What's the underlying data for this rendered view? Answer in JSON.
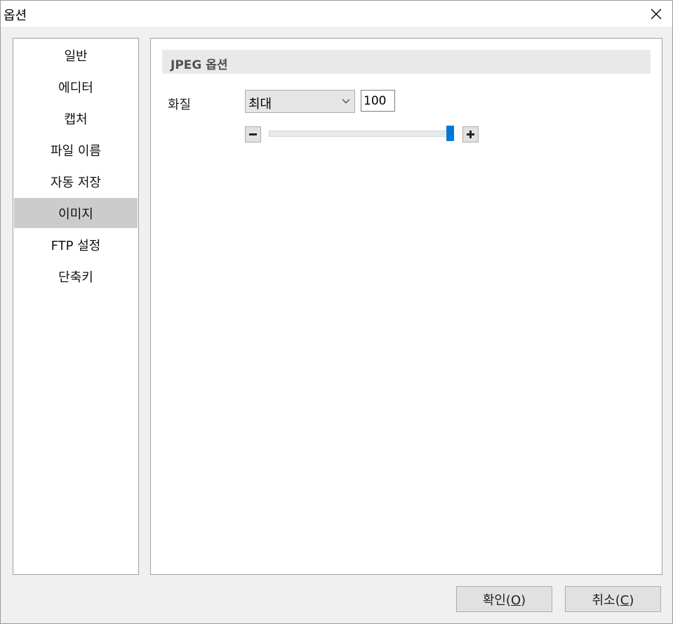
{
  "window": {
    "title": "옵션",
    "close_icon": "close-icon"
  },
  "sidebar": {
    "selected_index": 5,
    "items": [
      {
        "label": "일반"
      },
      {
        "label": "에디터"
      },
      {
        "label": "캡처"
      },
      {
        "label": "파일 이름"
      },
      {
        "label": "자동 저장"
      },
      {
        "label": "이미지"
      },
      {
        "label": "FTP 설정"
      },
      {
        "label": "단축키"
      }
    ]
  },
  "content": {
    "section_title": "JPEG 옵션",
    "quality_label": "화질",
    "quality_select_value": "최대",
    "quality_value": "100",
    "slider_value": 100,
    "slider_max": 100,
    "minus_icon": "minus-icon",
    "plus_icon": "plus-icon",
    "accent_color": "#0078d7"
  },
  "buttons": {
    "ok_prefix": "확인(",
    "ok_mnemonic": "O",
    "ok_suffix": ")",
    "cancel_prefix": "취소(",
    "cancel_mnemonic": "C",
    "cancel_suffix": ")"
  }
}
